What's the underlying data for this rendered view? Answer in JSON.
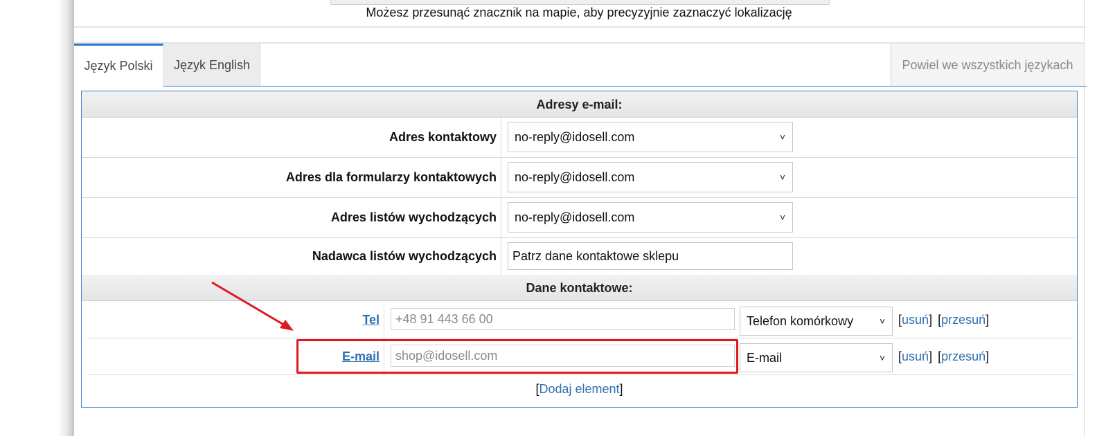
{
  "map": {
    "hint": "Możesz przesunąć znacznik na mapie, aby precyzyjnie zaznaczyć lokalizację"
  },
  "tabs": [
    {
      "label": "Język Polski",
      "active": true
    },
    {
      "label": "Język English",
      "active": false
    }
  ],
  "duplicate_all_label": "Powiel we wszystkich językach",
  "email_section": {
    "title": "Adresy e-mail:",
    "rows": [
      {
        "label": "Adres kontaktowy",
        "value": "no-reply@idosell.com",
        "kind": "select"
      },
      {
        "label": "Adres dla formularzy kontaktowych",
        "value": "no-reply@idosell.com",
        "kind": "select"
      },
      {
        "label": "Adres listów wychodzących",
        "value": "no-reply@idosell.com",
        "kind": "select"
      },
      {
        "label": "Nadawca listów wychodzących",
        "value": "Patrz dane kontaktowe sklepu",
        "kind": "text"
      }
    ]
  },
  "contact_section": {
    "title": "Dane kontaktowe:",
    "rows": [
      {
        "label": "Tel",
        "placeholder": "+48 91 443 66 00",
        "type_value": "Telefon komórkowy",
        "remove": "usuń",
        "move": "przesuń"
      },
      {
        "label": "E-mail",
        "placeholder": "shop@idosell.com",
        "type_value": "E-mail",
        "remove": "usuń",
        "move": "przesuń"
      }
    ],
    "add_label": "Dodaj element"
  },
  "annotation_color": "#e0191e",
  "icons": {
    "select_chevron": "chevron-down-icon"
  }
}
